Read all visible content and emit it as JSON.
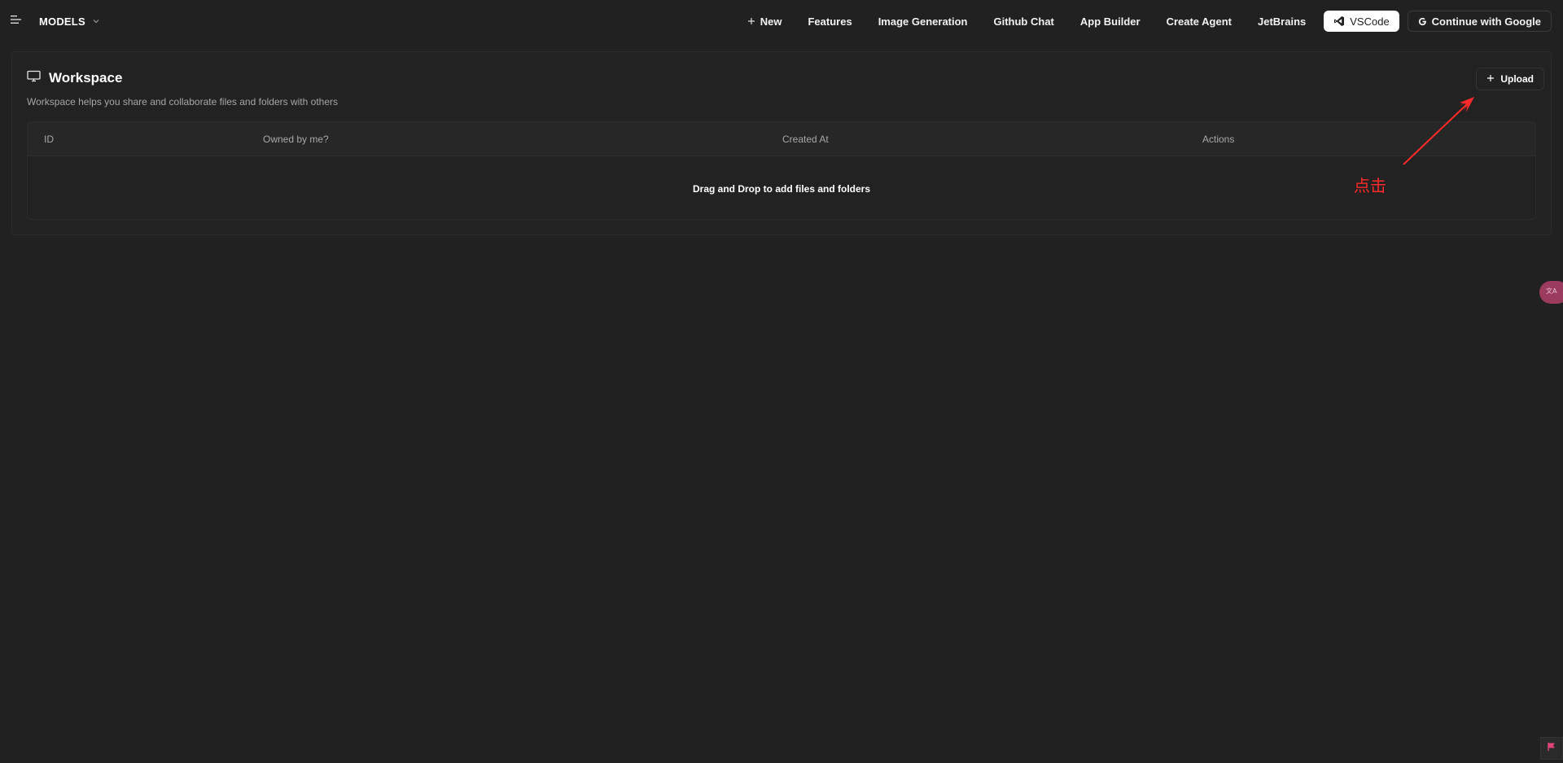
{
  "header": {
    "model_selector_label": "MODELS",
    "nav": {
      "new": "New",
      "features": "Features",
      "image_generation": "Image Generation",
      "github_chat": "Github Chat",
      "app_builder": "App Builder",
      "create_agent": "Create Agent",
      "jetbrains": "JetBrains",
      "vscode": "VSCode",
      "google_signin": "Continue with Google"
    }
  },
  "workspace": {
    "title": "Workspace",
    "description": "Workspace helps you share and collaborate files and folders with others",
    "upload_label": "Upload",
    "table": {
      "columns": [
        "ID",
        "Owned by me?",
        "Created At",
        "Actions"
      ],
      "empty_message": "Drag and Drop to add files and folders"
    }
  },
  "annotation": {
    "text": "点击",
    "color": "#ff2a2a"
  },
  "colors": {
    "background": "#212121",
    "accent_pink": "#9b3b5e",
    "annotation_red": "#ff2a2a"
  },
  "icons": {
    "menu": "menu-icon",
    "chevron": "chevron-down-icon",
    "plus": "plus-icon",
    "vscode": "vscode-icon",
    "google": "google-icon",
    "monitor": "monitor-icon",
    "translate": "translate-icon",
    "feedback": "flag-icon"
  }
}
